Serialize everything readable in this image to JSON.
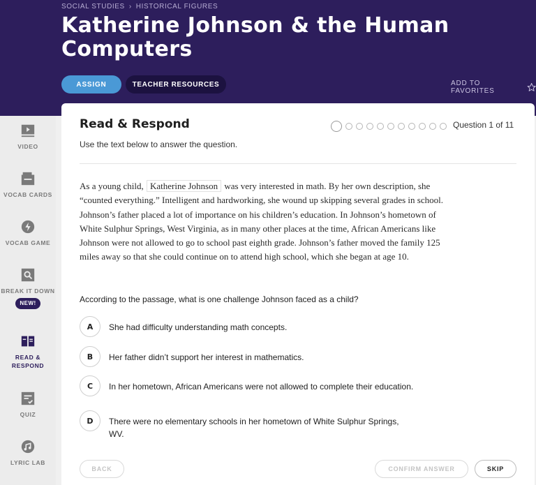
{
  "breadcrumb": {
    "section": "SOCIAL STUDIES",
    "subsection": "HISTORICAL FIGURES"
  },
  "title": "Katherine Johnson & the Human Computers",
  "actions": {
    "assign": "ASSIGN",
    "teacher_resources": "TEACHER RESOURCES",
    "add_to_favorites": "ADD TO FAVORITES"
  },
  "sidebar": {
    "items": [
      {
        "label": "VIDEO",
        "icon": "video-icon"
      },
      {
        "label": "VOCAB CARDS",
        "icon": "vocab-cards-icon"
      },
      {
        "label": "VOCAB GAME",
        "icon": "lightning-icon"
      },
      {
        "label": "BREAK IT DOWN",
        "icon": "magnifier-icon",
        "badge": "NEW!"
      },
      {
        "label": "READ & RESPOND",
        "icon": "book-icon",
        "active": true
      },
      {
        "label": "QUIZ",
        "icon": "quiz-icon"
      },
      {
        "label": "LYRIC LAB",
        "icon": "music-icon"
      }
    ]
  },
  "activity": {
    "heading": "Read & Respond",
    "instructions": "Use the text below to answer the question.",
    "progress": {
      "label": "Question 1 of 11",
      "current": 1,
      "total": 11
    },
    "passage": {
      "before": "As a young child, ",
      "highlight": "Katherine Johnson",
      "after": " was very interested in math. By her own description, she “counted everything.” Intelligent and hardworking, she wound up skipping several grades in school. Johnson’s father placed a lot of importance on his children’s education. In Johnson’s hometown of White Sulphur Springs, West Virginia, as in many other places at the time, African Americans like Johnson were not allowed to go to school past eighth grade. Johnson’s father moved the family 125 miles away so that she could continue on to attend high school, which she began at age 10."
    },
    "question": "According to the passage, what is one challenge Johnson faced as a child?",
    "choices": [
      {
        "letter": "A",
        "text": "She had difficulty understanding math concepts."
      },
      {
        "letter": "B",
        "text": "Her father didn’t support her interest in mathematics."
      },
      {
        "letter": "C",
        "text": "In her hometown, African Americans were not allowed to complete their education."
      },
      {
        "letter": "D",
        "text": "There were no elementary schools in her hometown of White Sulphur Springs, WV."
      }
    ],
    "buttons": {
      "back": "BACK",
      "confirm": "CONFIRM ANSWER",
      "skip": "SKIP"
    }
  },
  "colors": {
    "header_bg": "#2d1e5c",
    "assign_blue": "#4a99d6",
    "teacher_dark": "#1c1240"
  }
}
